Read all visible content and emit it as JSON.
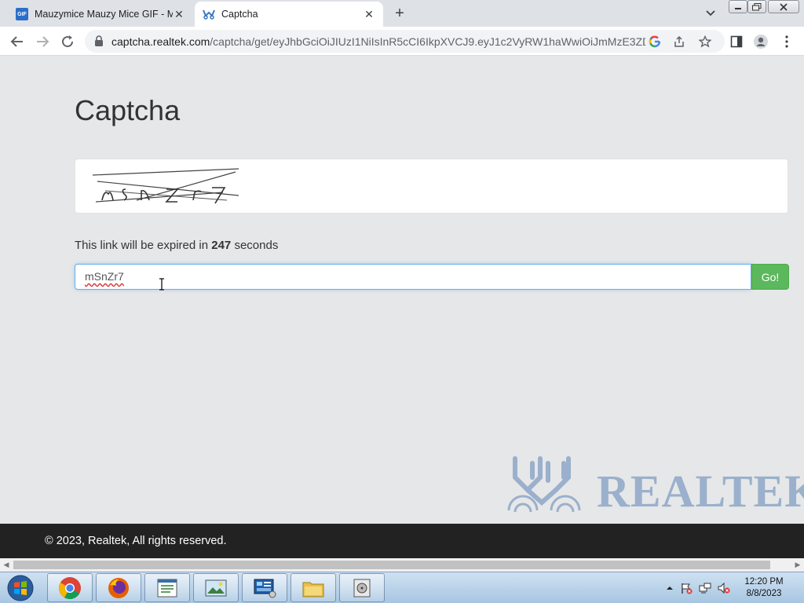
{
  "browser": {
    "tabs": [
      {
        "title": "Mauzymice Mauzy Mice GIF - Ma",
        "favicon": "GIF",
        "active": false
      },
      {
        "title": "Captcha",
        "active": true
      }
    ],
    "url_host": "captcha.realtek.com",
    "url_path": "/captcha/get/eyJhbGciOiJIUzI1NiIsInR5cCI6IkpXVCJ9.eyJ1c2VyRW1haWwiOiJmMzE3ZD..."
  },
  "page": {
    "title": "Captcha",
    "expire_prefix": "This link will be expired in",
    "expire_seconds": "247",
    "expire_suffix": "seconds",
    "captcha_input_value": "mSnZr7",
    "go_label": "Go!",
    "logo_text": "REALTEK",
    "footer": "© 2023, Realtek, All rights reserved."
  },
  "taskbar": {
    "time": "12:20 PM",
    "date": "8/8/2023"
  },
  "colors": {
    "go_button": "#5cb85c",
    "footer_bg": "#222222",
    "logo": "#9ab0cc",
    "input_focus": "#66afe9"
  }
}
